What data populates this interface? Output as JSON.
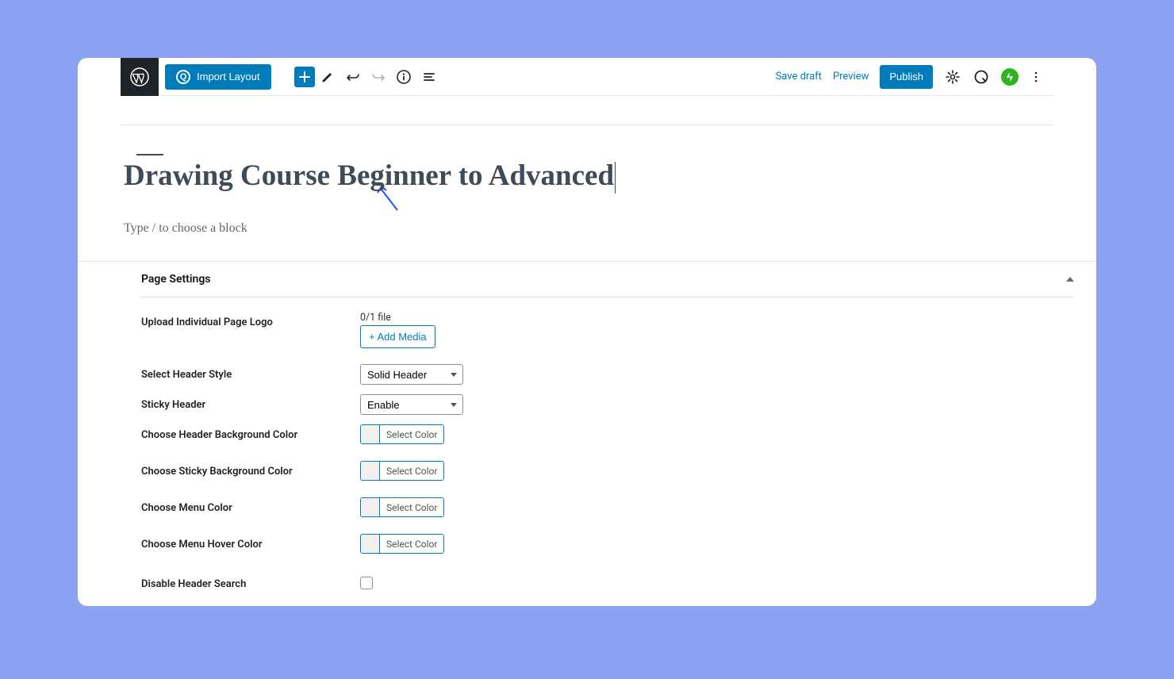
{
  "toolbar": {
    "import_layout": "Import Layout",
    "save_draft": "Save draft",
    "preview": "Preview",
    "publish": "Publish"
  },
  "page": {
    "title": "Drawing Course Beginner to Advanced",
    "placeholder": "Type / to choose a block"
  },
  "settings": {
    "header": "Page Settings",
    "rows": {
      "upload_logo": {
        "label": "Upload Individual Page Logo",
        "file_hint": "0/1 file",
        "button": "+ Add Media"
      },
      "header_style": {
        "label": "Select Header Style",
        "value": "Solid Header"
      },
      "sticky_header": {
        "label": "Sticky Header",
        "value": "Enable"
      },
      "header_bg": {
        "label": "Choose Header Background Color",
        "button": "Select Color"
      },
      "sticky_bg": {
        "label": "Choose Sticky Background Color",
        "button": "Select Color"
      },
      "menu_color": {
        "label": "Choose Menu Color",
        "button": "Select Color"
      },
      "menu_hover": {
        "label": "Choose Menu Hover Color",
        "button": "Select Color"
      },
      "disable_search": {
        "label": "Disable Header Search"
      }
    }
  }
}
